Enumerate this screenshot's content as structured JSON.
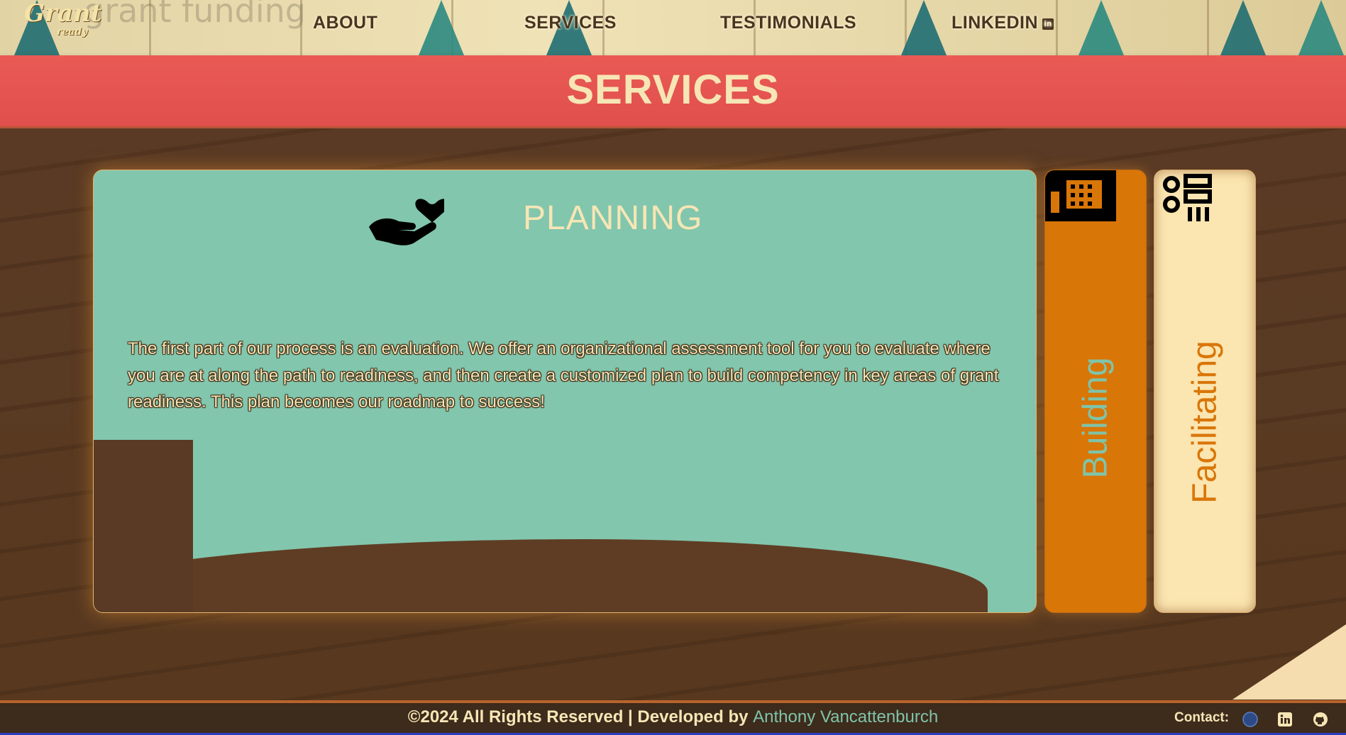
{
  "nav": {
    "logo_main": "Grant",
    "logo_sub": "ready",
    "ghost_text": "grant funding",
    "links": [
      "ABOUT",
      "SERVICES",
      "TESTIMONIALS",
      "LINKEDIN"
    ],
    "linkedin_badge": "in"
  },
  "banner": {
    "title": "SERVICES"
  },
  "main_card": {
    "title": "PLANNING",
    "icon": "hand-heart-icon",
    "text": "The first part of our process is an evaluation. We offer an organizational assessment tool for you to evaluate where you are at along the path to readiness, and then create a customized plan to build competency in key areas of grant readiness. This plan becomes our roadmap to success!"
  },
  "tabs": [
    {
      "label": "Building",
      "icon": "building-tools-icon"
    },
    {
      "label": "Facilitating",
      "icon": "facilitating-icon"
    }
  ],
  "footer": {
    "copyright": "©2024 All Rights Reserved | Developed by ",
    "developer": "Anthony Vancattenburch",
    "contact_label": "Contact:",
    "contact_icons": [
      "globe-icon",
      "linkedin-icon",
      "github-icon"
    ]
  },
  "colors": {
    "banner": "#e04f4c",
    "card": "#82c6ad",
    "accent_orange": "#d97608",
    "cream": "#f7e6b5",
    "wood": "#5a3a24"
  }
}
